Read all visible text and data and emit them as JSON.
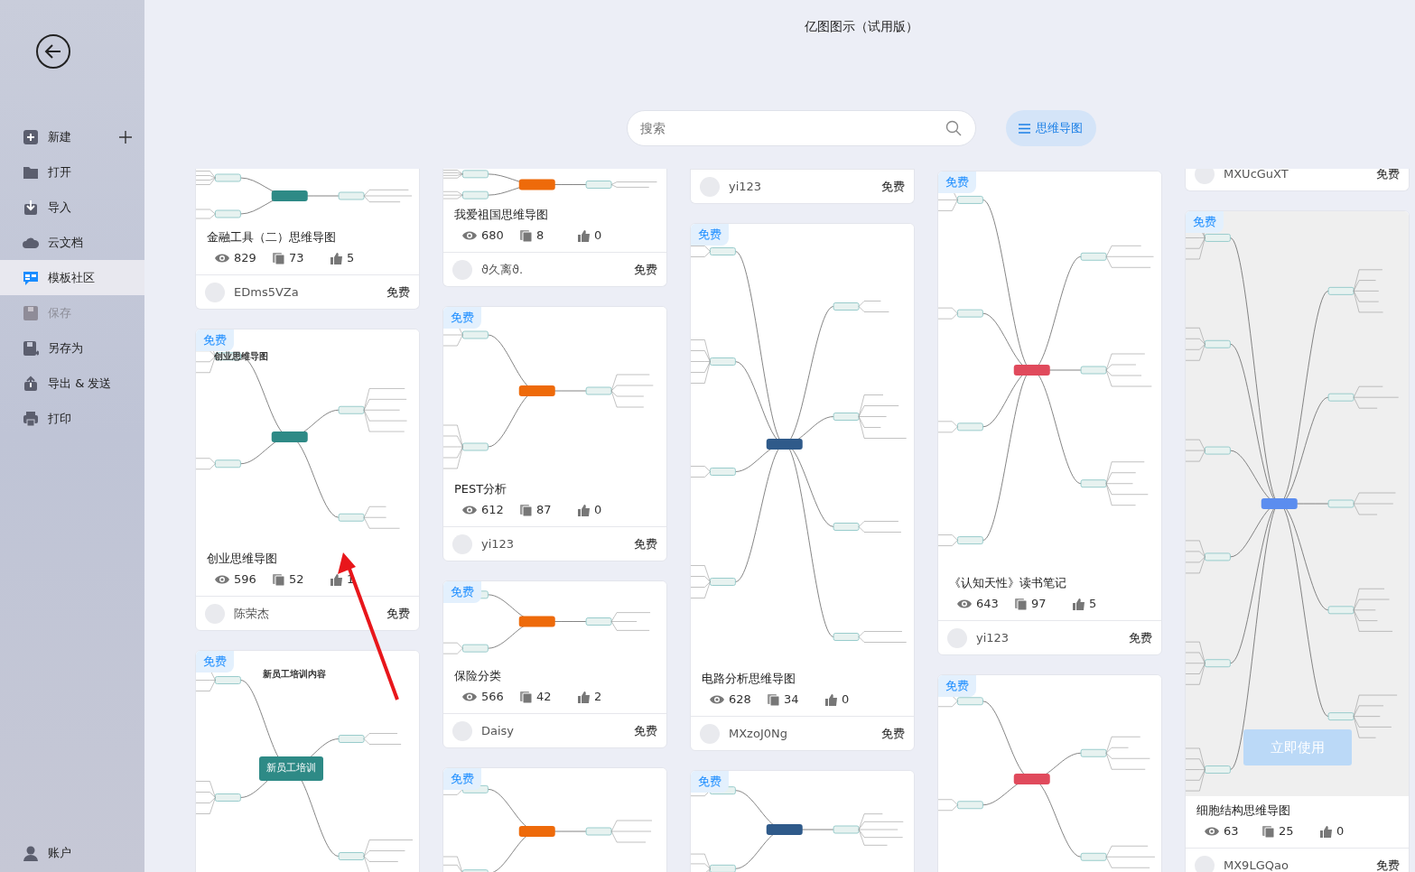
{
  "window": {
    "title": "亿图图示（试用版）"
  },
  "sidebar": {
    "items": [
      {
        "kind": "new",
        "label": "新建",
        "selected": false,
        "disabled": false
      },
      {
        "kind": "open",
        "label": "打开",
        "selected": false,
        "disabled": false
      },
      {
        "kind": "import",
        "label": "导入",
        "selected": false,
        "disabled": false
      },
      {
        "kind": "cloud",
        "label": "云文档",
        "selected": false,
        "disabled": false
      },
      {
        "kind": "community",
        "label": "模板社区",
        "selected": true,
        "disabled": false
      },
      {
        "kind": "save",
        "label": "保存",
        "selected": false,
        "disabled": true
      },
      {
        "kind": "saveas",
        "label": "另存为",
        "selected": false,
        "disabled": false
      },
      {
        "kind": "export",
        "label": "导出 & 发送",
        "selected": false,
        "disabled": false
      },
      {
        "kind": "print",
        "label": "打印",
        "selected": false,
        "disabled": false
      }
    ],
    "account": {
      "label": "账户"
    }
  },
  "search": {
    "placeholder": "搜索"
  },
  "filter_button": {
    "label": "思维导图"
  },
  "columns": [
    {
      "cards": [
        {
          "title": "金融工具（二）思维导图",
          "views": "829",
          "copies": "73",
          "likes": "5",
          "author": "EDms5VZa",
          "price": "免费"
        },
        {
          "tag": "免费",
          "preview_heading": "创业思维导图",
          "title": "创业思维导图",
          "views": "596",
          "copies": "52",
          "likes": "1",
          "author": "陈荣杰",
          "price": "免费"
        },
        {
          "tag": "免费",
          "preview_heading": "新员工培训内容",
          "preview_root": "新员工培训"
        }
      ]
    },
    {
      "cards": [
        {
          "title": "我爱祖国思维导图",
          "views": "680",
          "copies": "8",
          "likes": "0",
          "author": "ϑ久离ϑ.",
          "price": "免费"
        },
        {
          "tag": "免费",
          "title": "PEST分析",
          "views": "612",
          "copies": "87",
          "likes": "0",
          "author": "yi123",
          "price": "免费"
        },
        {
          "tag": "免费",
          "title": "保险分类",
          "views": "566",
          "copies": "42",
          "likes": "2",
          "author": "Daisy",
          "price": "免费"
        },
        {
          "tag": "免费"
        }
      ]
    },
    {
      "cards": [
        {
          "author": "yi123",
          "price": "免费"
        },
        {
          "tag": "免费",
          "title": "电路分析思维导图",
          "views": "628",
          "copies": "34",
          "likes": "0",
          "author": "MXzoJ0Ng",
          "price": "免费"
        },
        {
          "tag": "免费"
        }
      ]
    },
    {
      "cards": [
        {
          "tag": "免费",
          "title": "《认知天性》读书笔记",
          "views": "643",
          "copies": "97",
          "likes": "5",
          "author": "yi123",
          "price": "免费"
        },
        {
          "tag": "免费"
        }
      ]
    },
    {
      "cards": [
        {
          "author": "MXUcGuXT",
          "price": "免费"
        },
        {
          "tag": "免费",
          "hovered": true,
          "hover_button": "立即使用",
          "title": "细胞结构思维导图",
          "views": "63",
          "copies": "25",
          "likes": "0",
          "author": "MX9LGQao",
          "price": "免费"
        }
      ]
    }
  ]
}
